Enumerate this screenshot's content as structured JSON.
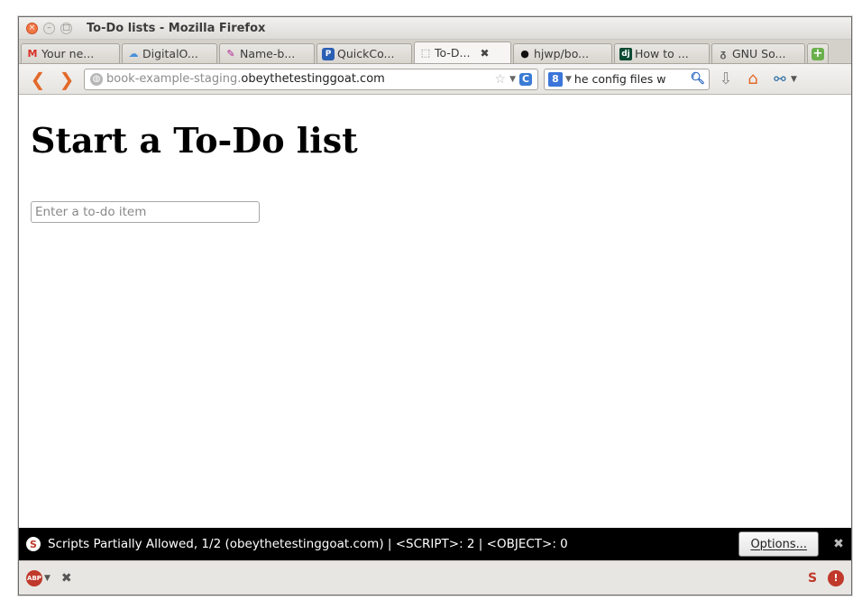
{
  "window": {
    "title": "To-Do lists - Mozilla Firefox",
    "buttons": {
      "close": "×",
      "minimize": "–",
      "maximize": "□"
    }
  },
  "tabs": [
    {
      "label": "Your ne...",
      "icon": "gmail-icon",
      "glyph": "M",
      "color": "#d93025"
    },
    {
      "label": "DigitalO...",
      "icon": "cloud-icon",
      "glyph": "☁",
      "color": "#4a90d9"
    },
    {
      "label": "Name-b...",
      "icon": "feather-icon",
      "glyph": "✎",
      "color": "#b0208f"
    },
    {
      "label": "QuickCo...",
      "icon": "python-icon",
      "glyph": "P",
      "color": "#2b5fb3"
    },
    {
      "label": "To-D...",
      "icon": "blank-page-icon",
      "glyph": "⬚",
      "color": "#777777",
      "active": true
    },
    {
      "label": "hjwp/bo...",
      "icon": "github-icon",
      "glyph": "●",
      "color": "#111111"
    },
    {
      "label": "How to ...",
      "icon": "django-icon",
      "glyph": "dj",
      "color": "#0c4b33"
    },
    {
      "label": "GNU So...",
      "icon": "gnu-icon",
      "glyph": "ᵹ",
      "color": "#555555"
    }
  ],
  "tab_close": "✖",
  "new_tab": "+",
  "nav": {
    "back": "❮",
    "forward": "❯",
    "url_host_dim": "book-example-staging.",
    "url_host": "obeythetestinggoat.com",
    "search_engine": "8",
    "search_text": "he config files w"
  },
  "page": {
    "heading": "Start a To-Do list",
    "input_placeholder": "Enter a to-do item"
  },
  "noscript": {
    "message": "Scripts Partially Allowed, 1/2 (obeythetestinggoat.com) | <SCRIPT>: 2 | <OBJECT>: 0",
    "options_label": "Options..."
  },
  "addon_bar": {
    "abp_label": "ABP"
  },
  "colors": {
    "accent_orange": "#e2692a",
    "noscript_bar": "#000000",
    "link_blue": "#3a7bd5"
  }
}
